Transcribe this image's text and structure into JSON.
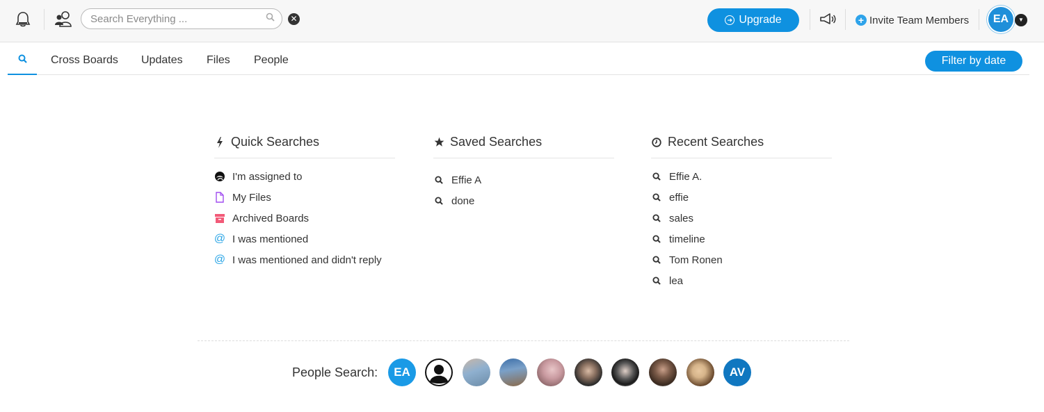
{
  "topbar": {
    "search_placeholder": "Search Everything ...",
    "upgrade_label": "Upgrade",
    "invite_label": "Invite Team Members",
    "user_initials": "EA"
  },
  "tabs": [
    {
      "label": "Cross Boards"
    },
    {
      "label": "Updates"
    },
    {
      "label": "Files"
    },
    {
      "label": "People"
    }
  ],
  "filter_label": "Filter by date",
  "quick": {
    "title": "Quick Searches",
    "items": [
      {
        "label": "I'm assigned to",
        "icon": "assigned-icon"
      },
      {
        "label": "My Files",
        "icon": "file-icon"
      },
      {
        "label": "Archived Boards",
        "icon": "archive-icon"
      },
      {
        "label": "I was mentioned",
        "icon": "at-icon"
      },
      {
        "label": "I was mentioned and didn't reply",
        "icon": "at-icon"
      }
    ]
  },
  "saved": {
    "title": "Saved Searches",
    "items": [
      {
        "label": "Effie A"
      },
      {
        "label": "done"
      }
    ]
  },
  "recent": {
    "title": "Recent Searches",
    "items": [
      {
        "label": "Effie A."
      },
      {
        "label": "effie"
      },
      {
        "label": "sales"
      },
      {
        "label": "timeline"
      },
      {
        "label": "Tom Ronen"
      },
      {
        "label": "lea"
      }
    ]
  },
  "people": {
    "label": "People Search:",
    "avatars": [
      {
        "initials": "EA",
        "color": "#1a9ae6"
      },
      {
        "type": "default-user",
        "color": "#111111"
      },
      {
        "type": "photo",
        "colors": [
          "#c9b7a8",
          "#6c8ca8"
        ]
      },
      {
        "type": "photo",
        "colors": [
          "#3d6fa8",
          "#8a6a4a"
        ]
      },
      {
        "type": "photo",
        "colors": [
          "#c99aa0",
          "#6a4a4a"
        ]
      },
      {
        "type": "photo",
        "colors": [
          "#e8e8e8",
          "#2a2a2a"
        ]
      },
      {
        "type": "photo",
        "colors": [
          "#d0d0d0",
          "#1a1a1a"
        ]
      },
      {
        "type": "photo",
        "colors": [
          "#a0a0a0",
          "#3a2a20"
        ]
      },
      {
        "type": "photo",
        "colors": [
          "#d6b48a",
          "#5a3a20"
        ]
      },
      {
        "initials": "AV",
        "color": "#1077c0"
      }
    ]
  },
  "colors": {
    "accent": "#0f91e0",
    "file_icon": "#a14df0",
    "archive_icon": "#f25a78",
    "at_icon": "#2aa5e6"
  }
}
